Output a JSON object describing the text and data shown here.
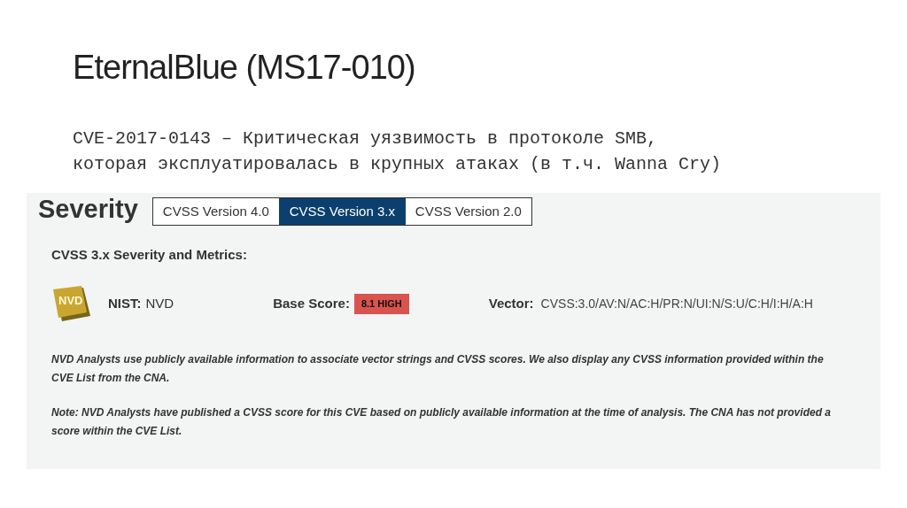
{
  "slide": {
    "title": "EternalBlue (MS17-010)",
    "subtitle_lines": [
      "CVE-2017-0143 – Критическая уязвимость в протоколе SMB,",
      "которая эксплуатировалась в крупных атаках (в т.ч. Wanna Cry)"
    ]
  },
  "panel": {
    "heading": "Severity",
    "tabs": [
      {
        "label": "CVSS Version 4.0",
        "selected": false
      },
      {
        "label": "CVSS Version 3.x",
        "selected": true
      },
      {
        "label": "CVSS Version 2.0",
        "selected": false
      }
    ],
    "section_title": "CVSS 3.x Severity and Metrics:",
    "source": {
      "logo": "NVD",
      "label": "NIST:",
      "value": "NVD"
    },
    "base_score": {
      "label": "Base Score:",
      "value": "8.1 HIGH",
      "color": "#d9534f"
    },
    "vector": {
      "label": "Vector:",
      "value": "CVSS:3.0/AV:N/AC:H/PR:N/UI:N/S:U/C:H/I:H/A:H"
    },
    "notes": [
      "NVD Analysts use publicly available information to associate vector strings and CVSS scores. We also display any CVSS information provided within the CVE List from the CNA.",
      "Note: NVD Analysts have published a CVSS score for this CVE based on publicly available information at the time of analysis. The CNA has not provided a score within the CVE List."
    ]
  }
}
